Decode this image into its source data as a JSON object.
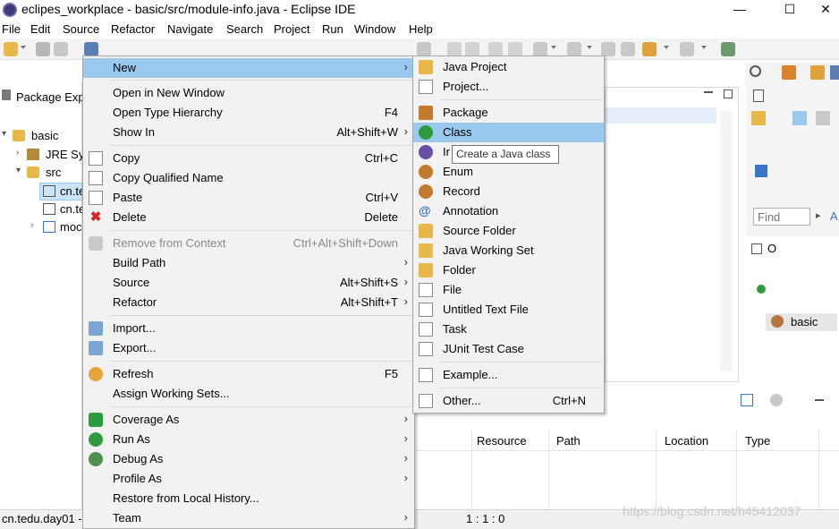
{
  "window": {
    "title": "eclipes_workplace - basic/src/module-info.java - Eclipse IDE",
    "minimize": "—",
    "maximize": "☐",
    "close": "✕"
  },
  "menubar": [
    "File",
    "Edit",
    "Source",
    "Refactor",
    "Navigate",
    "Search",
    "Project",
    "Run",
    "Window",
    "Help"
  ],
  "package_explorer": {
    "tab_label": "Package Exp",
    "tree": [
      {
        "label": "basic",
        "arrow": "▾"
      },
      {
        "label": "JRE Sys",
        "arrow": "›"
      },
      {
        "label": "src",
        "arrow": "▾"
      },
      {
        "label": "cn.te",
        "arrow": ""
      },
      {
        "label": "cn.te",
        "arrow": ""
      },
      {
        "label": "moc",
        "arrow": "›"
      }
    ]
  },
  "context_menu": [
    {
      "label": "New",
      "shortcut": "",
      "submenu": true,
      "highlighted": true
    },
    {
      "label": "Open in New Window",
      "shortcut": ""
    },
    {
      "label": "Open Type Hierarchy",
      "shortcut": "F4"
    },
    {
      "label": "Show In",
      "shortcut": "Alt+Shift+W",
      "submenu": true
    },
    {
      "label": "Copy",
      "shortcut": "Ctrl+C"
    },
    {
      "label": "Copy Qualified Name",
      "shortcut": ""
    },
    {
      "label": "Paste",
      "shortcut": "Ctrl+V"
    },
    {
      "label": "Delete",
      "shortcut": "Delete"
    },
    {
      "label": "Remove from Context",
      "shortcut": "Ctrl+Alt+Shift+Down",
      "disabled": true
    },
    {
      "label": "Build Path",
      "shortcut": "",
      "submenu": true
    },
    {
      "label": "Source",
      "shortcut": "Alt+Shift+S",
      "submenu": true
    },
    {
      "label": "Refactor",
      "shortcut": "Alt+Shift+T",
      "submenu": true
    },
    {
      "label": "Import...",
      "shortcut": ""
    },
    {
      "label": "Export...",
      "shortcut": ""
    },
    {
      "label": "Refresh",
      "shortcut": "F5"
    },
    {
      "label": "Assign Working Sets...",
      "shortcut": ""
    },
    {
      "label": "Coverage As",
      "shortcut": "",
      "submenu": true
    },
    {
      "label": "Run As",
      "shortcut": "",
      "submenu": true
    },
    {
      "label": "Debug As",
      "shortcut": "",
      "submenu": true
    },
    {
      "label": "Profile As",
      "shortcut": "",
      "submenu": true
    },
    {
      "label": "Restore from Local History...",
      "shortcut": ""
    },
    {
      "label": "Team",
      "shortcut": "",
      "submenu": true
    }
  ],
  "new_submenu": [
    {
      "label": "Java Project",
      "shortcut": ""
    },
    {
      "label": "Project...",
      "shortcut": ""
    },
    {
      "label": "Package",
      "shortcut": ""
    },
    {
      "label": "Class",
      "shortcut": "",
      "highlighted": true
    },
    {
      "label": "Ir",
      "shortcut": ""
    },
    {
      "label": "Enum",
      "shortcut": ""
    },
    {
      "label": "Record",
      "shortcut": ""
    },
    {
      "label": "Annotation",
      "shortcut": ""
    },
    {
      "label": "Source Folder",
      "shortcut": ""
    },
    {
      "label": "Java Working Set",
      "shortcut": ""
    },
    {
      "label": "Folder",
      "shortcut": ""
    },
    {
      "label": "File",
      "shortcut": ""
    },
    {
      "label": "Untitled Text File",
      "shortcut": ""
    },
    {
      "label": "Task",
      "shortcut": ""
    },
    {
      "label": "JUnit Test Case",
      "shortcut": ""
    },
    {
      "label": "Example...",
      "shortcut": ""
    },
    {
      "label": "Other...",
      "shortcut": "Ctrl+N"
    }
  ],
  "tooltip": "Create a Java class",
  "right_panel": {
    "find_placeholder": "Find",
    "outline_item": "basic"
  },
  "problems_columns": [
    "Resource",
    "Path",
    "Location",
    "Type"
  ],
  "status": {
    "selection": "cn.tedu.day01 -",
    "position": "1 : 1 : 0"
  },
  "watermark": "https://blog.csdn.net/h45412037"
}
